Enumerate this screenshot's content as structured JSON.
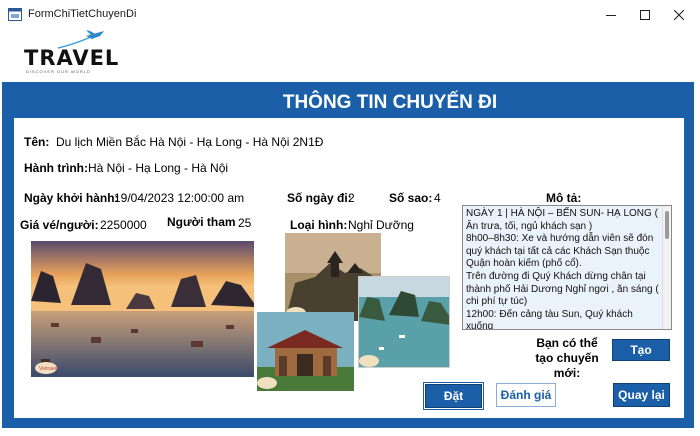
{
  "window": {
    "title": "FormChiTietChuyenDi"
  },
  "logo": {
    "text": "TRAVEL",
    "tagline": "DISCOVER OUR WORLD"
  },
  "header": {
    "title": "THÔNG TIN CHUYẾN ĐI"
  },
  "trip": {
    "name_label": "Tên:",
    "name_value": "Du lịch Miền Bắc Hà Nội - Hạ Long - Hà Nội 2N1Đ",
    "route_label": "Hành trình:",
    "route_value": "Hà Nội - Hạ Long - Hà Nội",
    "start_label": "Ngày khởi hành:",
    "start_value": "19/04/2023 12:00:00 am",
    "days_label": "Số ngày đi:",
    "days_value": "2",
    "stars_label": "Số sao:",
    "stars_value": "4",
    "price_label": "Giá vé/người:",
    "price_value": "2250000",
    "people_label": "Người tham",
    "people_value": "25",
    "type_label": "Loại hình:",
    "type_value": "Nghỉ Dưỡng",
    "desc_label": "Mô tả:",
    "desc_lines": [
      "NGÀY 1 | HÀ NỘI – BẾN SUN- HẠ LONG ( Ăn trưa, tối, ngủ khách sạn )",
      "8h00–8h30: Xe và hướng dẫn viên sẽ đón quý khách tại tất cả các Khách Sạn thuộc Quận hoàn kiếm (phố cổ).",
      "Trên đường đi Quý Khách dừng chân tại thành phố Hải Dương Nghỉ ngơi , ăn sáng ( chi phí tự túc)",
      "12h00: Đến cảng tàu Sun, Quý khách xuống"
    ]
  },
  "create": {
    "prompt": "Bạn có thể tạo chuyến mới:",
    "button": "Tạo"
  },
  "actions": {
    "book": "Đặt",
    "review": "Đánh giá",
    "back": "Quay lại"
  },
  "colors": {
    "frame": "#1a5fa8",
    "desc_bg": "#eaf2fb",
    "button": "#1a5fa8"
  }
}
